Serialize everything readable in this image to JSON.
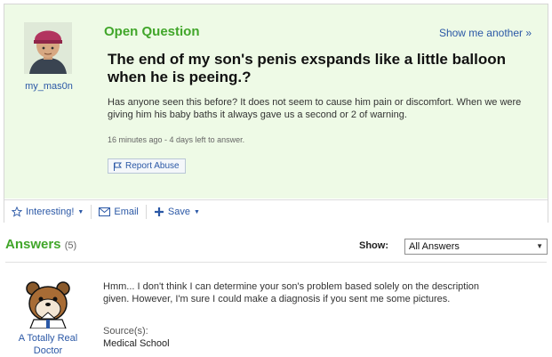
{
  "question": {
    "status_label": "Open Question",
    "show_another": "Show me another »",
    "asker": "my_mas0n",
    "title": "The end of my son's penis exspands like a little balloon when he is peeing.?",
    "body": "Has anyone seen this before? It does not seem to cause him pain or discomfort. When we were giving him his baby baths it always gave us a second or 2 of warning.",
    "meta": "16 minutes ago - 4 days left to answer.",
    "report_label": "Report Abuse"
  },
  "actions": {
    "interesting": "Interesting!",
    "email": "Email",
    "save": "Save"
  },
  "answers": {
    "title": "Answers",
    "count": "(5)",
    "show_label": "Show:",
    "filter_value": "All Answers",
    "items": [
      {
        "author": "A Totally Real Doctor",
        "text": "Hmm... I don't think I can determine your son's problem based solely on the description given. However, I'm sure I could make a diagnosis if you sent me some pictures.",
        "source_label": "Source(s):",
        "source": "Medical School"
      }
    ]
  },
  "colors": {
    "accent_green": "#41a62a",
    "link_blue": "#2b58a6",
    "question_bg": "#eefae6"
  }
}
